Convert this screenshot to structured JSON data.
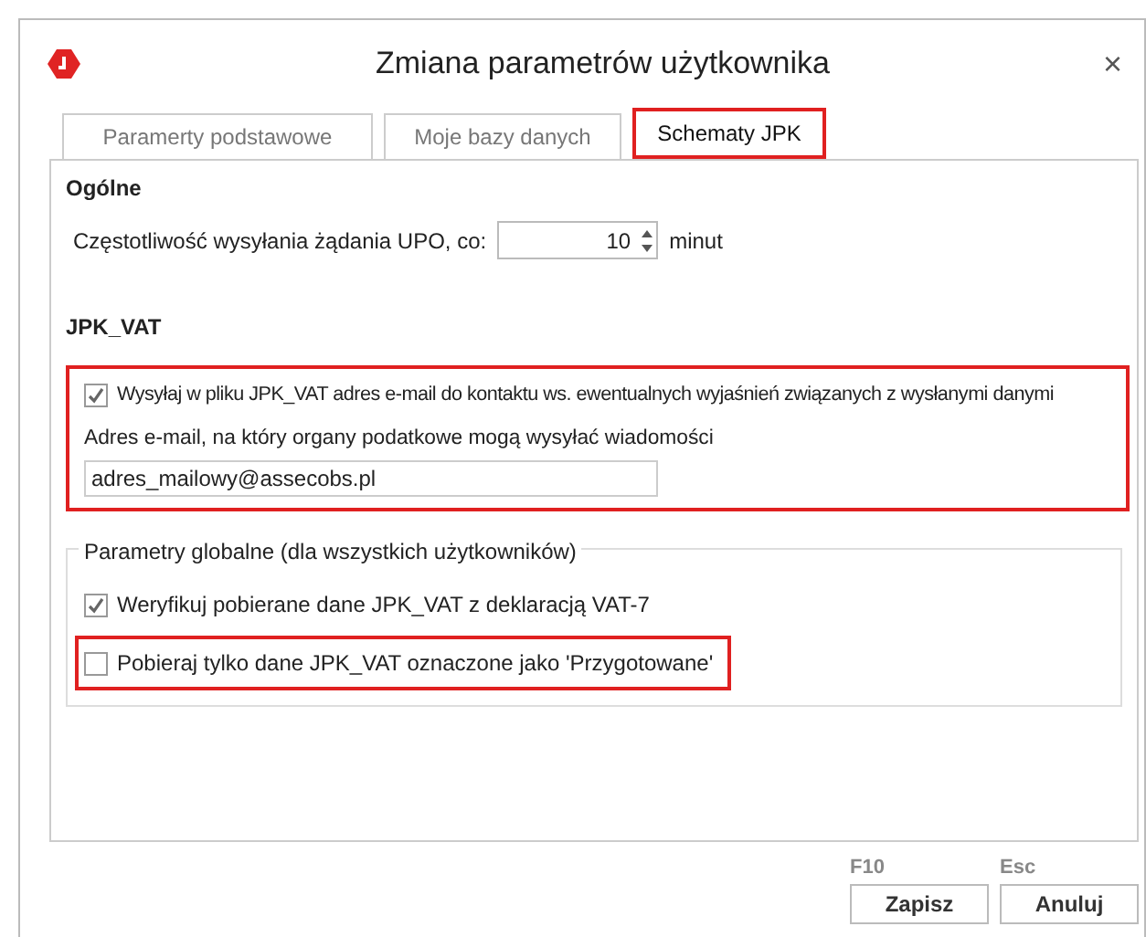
{
  "window": {
    "title": "Zmiana parametrów użytkownika",
    "close": "×"
  },
  "tabs": [
    {
      "label": "Paramerty podstawowe",
      "selected": false
    },
    {
      "label": "Moje bazy danych",
      "selected": false
    },
    {
      "label": "Schematy JPK",
      "selected": true
    }
  ],
  "general": {
    "heading": "Ogólne",
    "upo_label": "Częstotliwość wysyłania żądania UPO, co:",
    "upo_value": "10",
    "upo_unit": "minut"
  },
  "jpk_vat": {
    "heading": "JPK_VAT",
    "send_email": {
      "label": "Wysyłaj w pliku JPK_VAT adres e-mail do kontaktu ws. ewentualnych wyjaśnień związanych z wysłanymi danymi",
      "checked": true
    },
    "email_label": "Adres e-mail, na który organy podatkowe mogą wysyłać wiadomości",
    "email_value": "adres_mailowy@assecobs.pl"
  },
  "global": {
    "legend": "Parametry globalne (dla wszystkich użytkowników)",
    "options": [
      {
        "label": "Weryfikuj pobierane dane JPK_VAT z deklaracją VAT-7",
        "checked": true,
        "highlighted": false
      },
      {
        "label": "Pobieraj tylko dane JPK_VAT oznaczone jako 'Przygotowane'",
        "checked": false,
        "highlighted": true
      }
    ]
  },
  "buttons": [
    {
      "shortcut": "F10",
      "label": "Zapisz"
    },
    {
      "shortcut": "Esc",
      "label": "Anuluj"
    }
  ]
}
